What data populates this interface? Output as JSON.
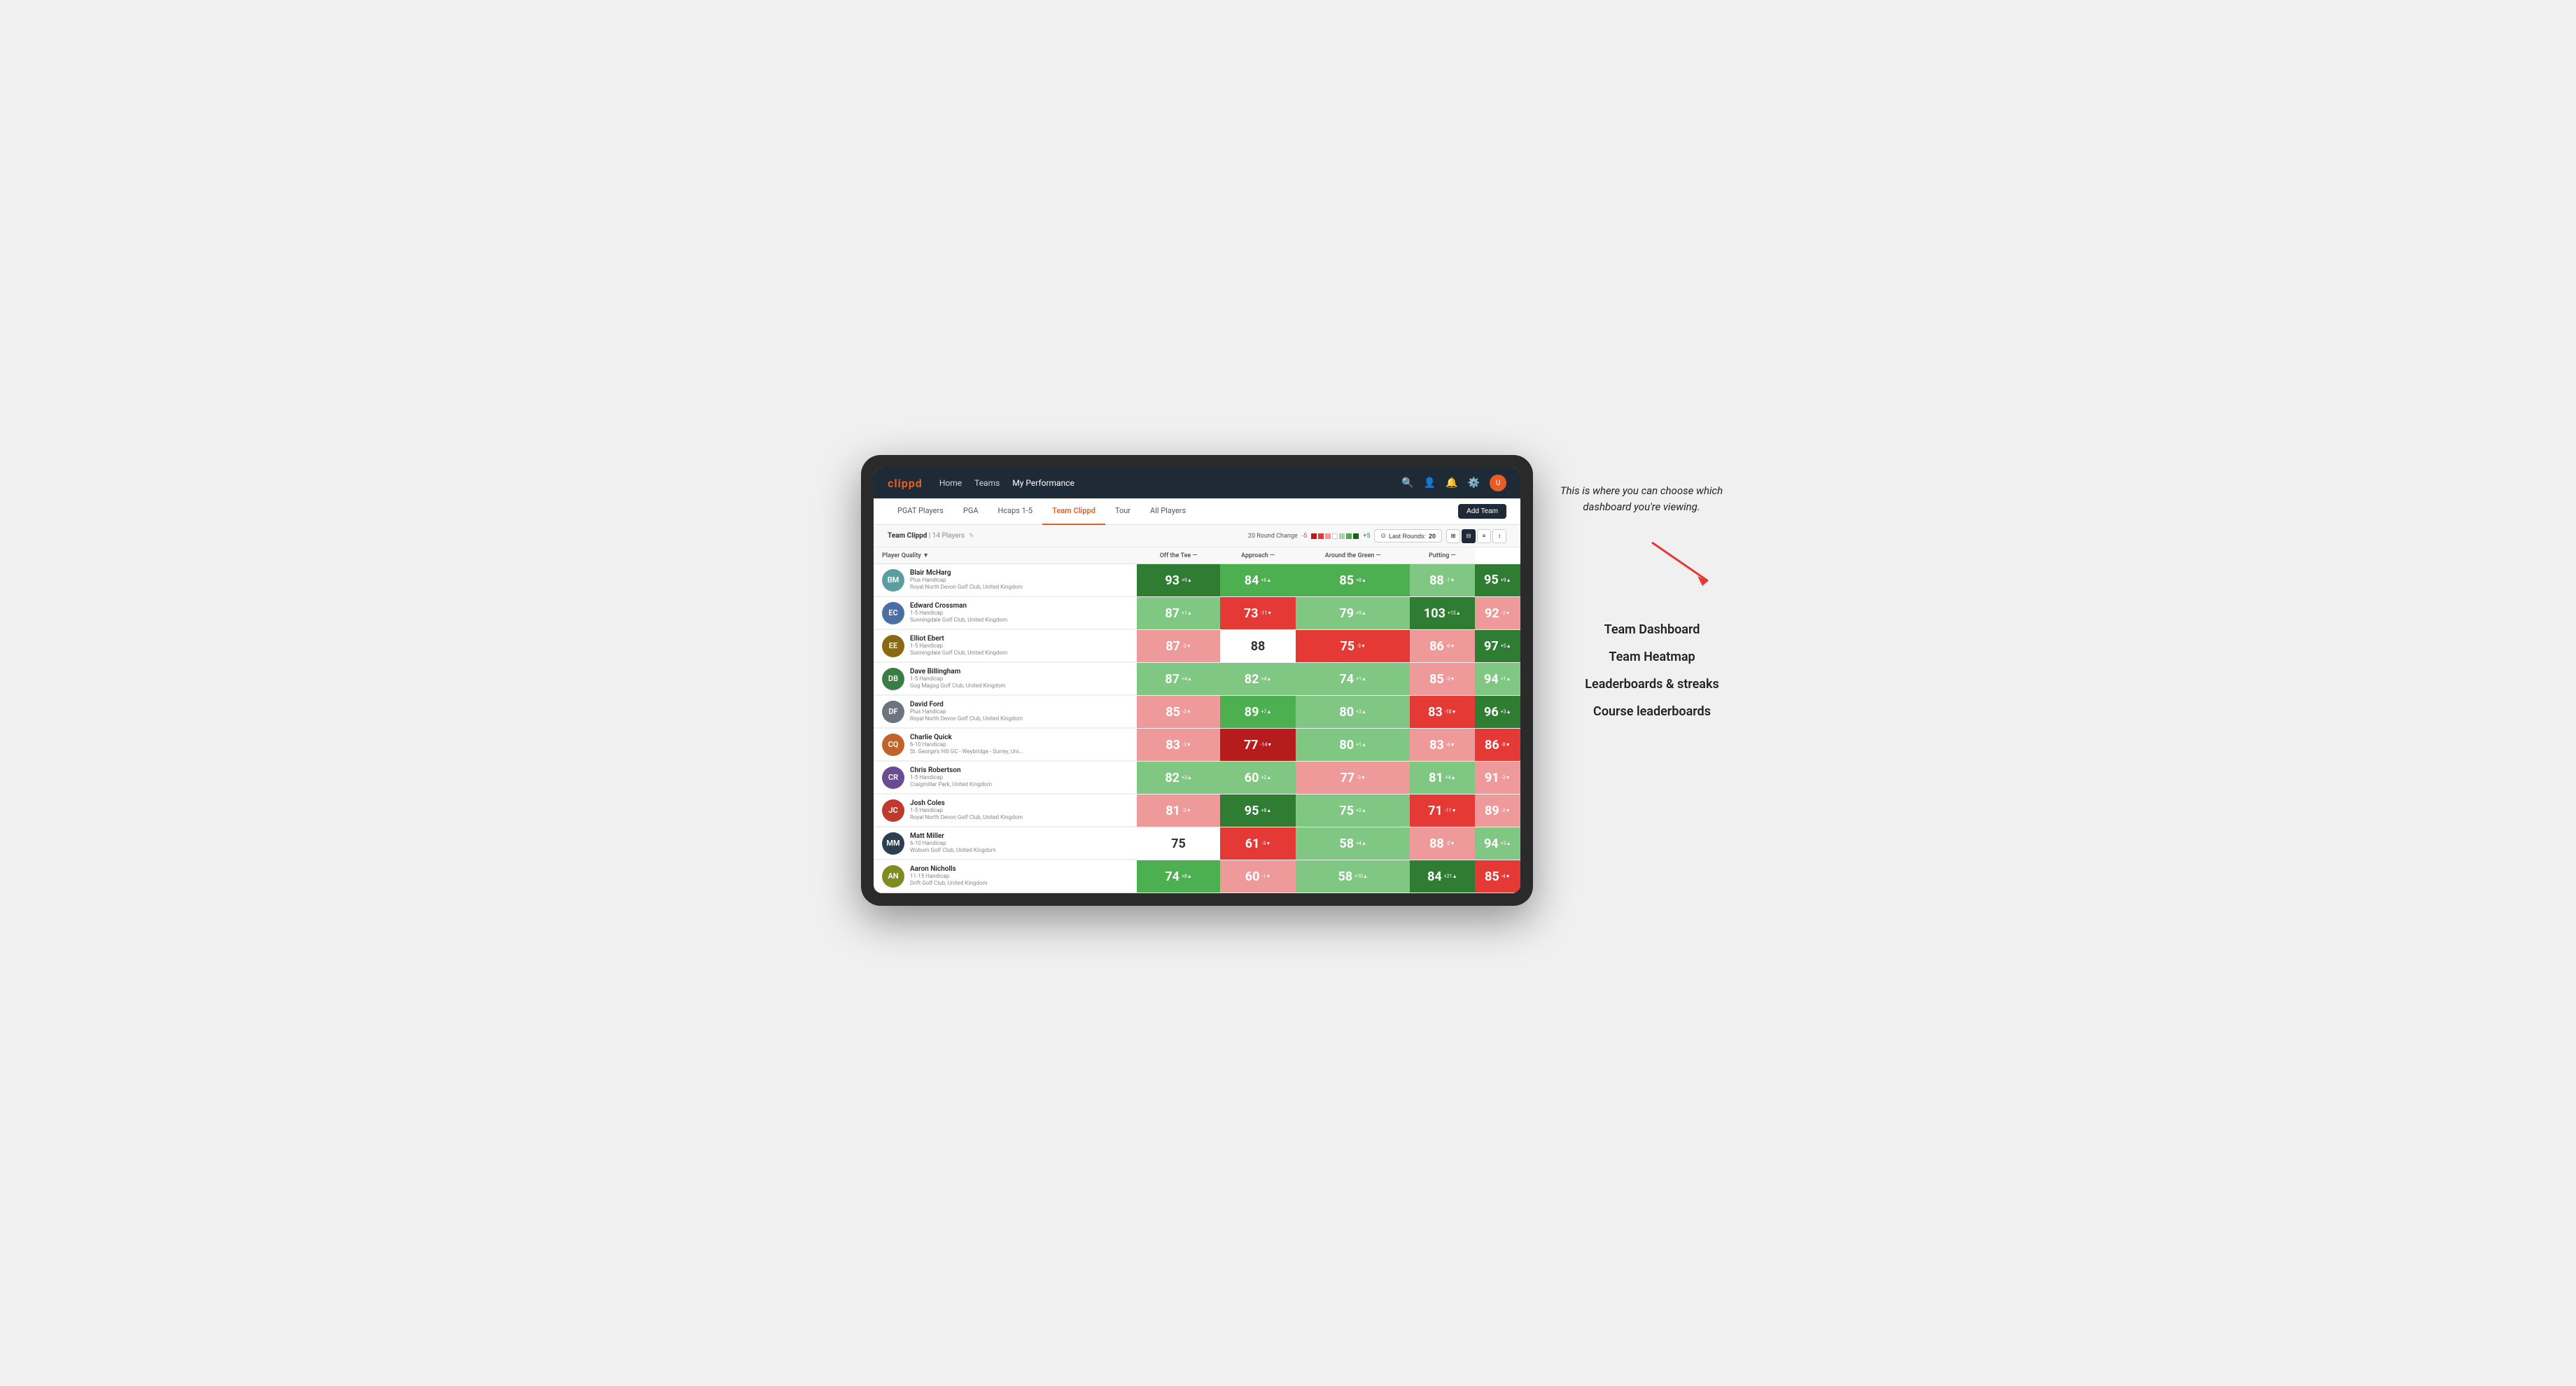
{
  "app": {
    "logo": "clippd",
    "nav": {
      "links": [
        "Home",
        "Teams",
        "My Performance"
      ],
      "active": "My Performance"
    },
    "icons": {
      "search": "🔍",
      "person": "👤",
      "bell": "🔔",
      "settings": "⚙",
      "avatar": "U"
    }
  },
  "tabs": {
    "items": [
      "PGAT Players",
      "PGA",
      "Hcaps 1-5",
      "Team Clippd",
      "Tour",
      "All Players"
    ],
    "active": "Team Clippd",
    "add_button": "Add Team"
  },
  "sub_header": {
    "team_name": "Team Clippd",
    "separator": " | ",
    "player_count": "14 Players",
    "round_change_label": "20 Round Change",
    "scale_minus": "-5",
    "scale_plus": "+5",
    "last_rounds_label": "Last Rounds:",
    "last_rounds_value": "20"
  },
  "table": {
    "headers": {
      "player": "Player Quality ▼",
      "off_tee": "Off the Tee —",
      "approach": "Approach —",
      "around_green": "Around the Green —",
      "putting": "Putting —"
    },
    "rows": [
      {
        "id": 1,
        "name": "Blair McHarg",
        "handicap": "Plus Handicap",
        "club": "Royal North Devon Golf Club, United Kingdom",
        "avatar_color": "av-teal",
        "avatar_text": "BM",
        "scores": {
          "quality": {
            "value": 93,
            "change": "+9",
            "dir": "up",
            "color": "dark-green"
          },
          "off_tee": {
            "value": 84,
            "change": "+6",
            "dir": "up",
            "color": "green"
          },
          "approach": {
            "value": 85,
            "change": "+8",
            "dir": "up",
            "color": "green"
          },
          "around_green": {
            "value": 88,
            "change": "-1",
            "dir": "down",
            "color": "light-green"
          },
          "putting": {
            "value": 95,
            "change": "+9",
            "dir": "up",
            "color": "dark-green"
          }
        }
      },
      {
        "id": 2,
        "name": "Edward Crossman",
        "handicap": "1-5 Handicap",
        "club": "Sunningdale Golf Club, United Kingdom",
        "avatar_color": "av-blue",
        "avatar_text": "EC",
        "scores": {
          "quality": {
            "value": 87,
            "change": "+1",
            "dir": "up",
            "color": "light-green"
          },
          "off_tee": {
            "value": 73,
            "change": "-11",
            "dir": "down",
            "color": "red"
          },
          "approach": {
            "value": 79,
            "change": "+9",
            "dir": "up",
            "color": "light-green"
          },
          "around_green": {
            "value": 103,
            "change": "+15",
            "dir": "up",
            "color": "dark-green"
          },
          "putting": {
            "value": 92,
            "change": "-3",
            "dir": "down",
            "color": "light-red"
          }
        }
      },
      {
        "id": 3,
        "name": "Elliot Ebert",
        "handicap": "1-5 Handicap",
        "club": "Sunningdale Golf Club, United Kingdom",
        "avatar_color": "av-brown",
        "avatar_text": "EE",
        "scores": {
          "quality": {
            "value": 87,
            "change": "-3",
            "dir": "down",
            "color": "light-red"
          },
          "off_tee": {
            "value": 88,
            "change": "",
            "dir": "",
            "color": "white"
          },
          "approach": {
            "value": 75,
            "change": "-3",
            "dir": "down",
            "color": "red"
          },
          "around_green": {
            "value": 86,
            "change": "-6",
            "dir": "down",
            "color": "light-red"
          },
          "putting": {
            "value": 97,
            "change": "+5",
            "dir": "up",
            "color": "dark-green"
          }
        }
      },
      {
        "id": 4,
        "name": "Dave Billingham",
        "handicap": "1-5 Handicap",
        "club": "Gog Magog Golf Club, United Kingdom",
        "avatar_color": "av-green",
        "avatar_text": "DB",
        "scores": {
          "quality": {
            "value": 87,
            "change": "+4",
            "dir": "up",
            "color": "light-green"
          },
          "off_tee": {
            "value": 82,
            "change": "+4",
            "dir": "up",
            "color": "light-green"
          },
          "approach": {
            "value": 74,
            "change": "+1",
            "dir": "up",
            "color": "light-green"
          },
          "around_green": {
            "value": 85,
            "change": "-3",
            "dir": "down",
            "color": "light-red"
          },
          "putting": {
            "value": 94,
            "change": "+1",
            "dir": "up",
            "color": "light-green"
          }
        }
      },
      {
        "id": 5,
        "name": "David Ford",
        "handicap": "Plus Handicap",
        "club": "Royal North Devon Golf Club, United Kingdom",
        "avatar_color": "av-gray",
        "avatar_text": "DF",
        "scores": {
          "quality": {
            "value": 85,
            "change": "-3",
            "dir": "down",
            "color": "light-red"
          },
          "off_tee": {
            "value": 89,
            "change": "+7",
            "dir": "up",
            "color": "green"
          },
          "approach": {
            "value": 80,
            "change": "+3",
            "dir": "up",
            "color": "light-green"
          },
          "around_green": {
            "value": 83,
            "change": "-10",
            "dir": "down",
            "color": "red"
          },
          "putting": {
            "value": 96,
            "change": "+3",
            "dir": "up",
            "color": "dark-green"
          }
        }
      },
      {
        "id": 6,
        "name": "Charlie Quick",
        "handicap": "6-10 Handicap",
        "club": "St. George's Hill GC - Weybridge - Surrey, Uni...",
        "avatar_color": "av-orange",
        "avatar_text": "CQ",
        "scores": {
          "quality": {
            "value": 83,
            "change": "-3",
            "dir": "down",
            "color": "light-red"
          },
          "off_tee": {
            "value": 77,
            "change": "-14",
            "dir": "down",
            "color": "dark-red"
          },
          "approach": {
            "value": 80,
            "change": "+1",
            "dir": "up",
            "color": "light-green"
          },
          "around_green": {
            "value": 83,
            "change": "-6",
            "dir": "down",
            "color": "light-red"
          },
          "putting": {
            "value": 86,
            "change": "-8",
            "dir": "down",
            "color": "red"
          }
        }
      },
      {
        "id": 7,
        "name": "Chris Robertson",
        "handicap": "1-5 Handicap",
        "club": "Craigmillar Park, United Kingdom",
        "avatar_color": "av-purple",
        "avatar_text": "CR",
        "scores": {
          "quality": {
            "value": 82,
            "change": "+3",
            "dir": "up",
            "color": "light-green"
          },
          "off_tee": {
            "value": 60,
            "change": "+2",
            "dir": "up",
            "color": "light-green"
          },
          "approach": {
            "value": 77,
            "change": "-3",
            "dir": "down",
            "color": "light-red"
          },
          "around_green": {
            "value": 81,
            "change": "+4",
            "dir": "up",
            "color": "light-green"
          },
          "putting": {
            "value": 91,
            "change": "-3",
            "dir": "down",
            "color": "light-red"
          }
        }
      },
      {
        "id": 8,
        "name": "Josh Coles",
        "handicap": "1-5 Handicap",
        "club": "Royal North Devon Golf Club, United Kingdom",
        "avatar_color": "av-red",
        "avatar_text": "JC",
        "scores": {
          "quality": {
            "value": 81,
            "change": "-3",
            "dir": "down",
            "color": "light-red"
          },
          "off_tee": {
            "value": 95,
            "change": "+8",
            "dir": "up",
            "color": "dark-green"
          },
          "approach": {
            "value": 75,
            "change": "+2",
            "dir": "up",
            "color": "light-green"
          },
          "around_green": {
            "value": 71,
            "change": "-11",
            "dir": "down",
            "color": "red"
          },
          "putting": {
            "value": 89,
            "change": "-2",
            "dir": "down",
            "color": "light-red"
          }
        }
      },
      {
        "id": 9,
        "name": "Matt Miller",
        "handicap": "6-10 Handicap",
        "club": "Woburn Golf Club, United Kingdom",
        "avatar_color": "av-dark",
        "avatar_text": "MM",
        "scores": {
          "quality": {
            "value": 75,
            "change": "",
            "dir": "",
            "color": "white"
          },
          "off_tee": {
            "value": 61,
            "change": "-3",
            "dir": "down",
            "color": "red"
          },
          "approach": {
            "value": 58,
            "change": "+4",
            "dir": "up",
            "color": "light-green"
          },
          "around_green": {
            "value": 88,
            "change": "-2",
            "dir": "down",
            "color": "light-red"
          },
          "putting": {
            "value": 94,
            "change": "+3",
            "dir": "up",
            "color": "light-green"
          }
        }
      },
      {
        "id": 10,
        "name": "Aaron Nicholls",
        "handicap": "11-15 Handicap",
        "club": "Drift Golf Club, United Kingdom",
        "avatar_color": "av-olive",
        "avatar_text": "AN",
        "scores": {
          "quality": {
            "value": 74,
            "change": "+8",
            "dir": "up",
            "color": "green"
          },
          "off_tee": {
            "value": 60,
            "change": "-1",
            "dir": "down",
            "color": "light-red"
          },
          "approach": {
            "value": 58,
            "change": "+10",
            "dir": "up",
            "color": "light-green"
          },
          "around_green": {
            "value": 84,
            "change": "+21",
            "dir": "up",
            "color": "dark-green"
          },
          "putting": {
            "value": 85,
            "change": "-4",
            "dir": "down",
            "color": "red"
          }
        }
      }
    ]
  },
  "annotation": {
    "intro_text": "This is where you can choose which dashboard you're viewing.",
    "options": [
      "Team Dashboard",
      "Team Heatmap",
      "Leaderboards & streaks",
      "Course leaderboards"
    ]
  }
}
